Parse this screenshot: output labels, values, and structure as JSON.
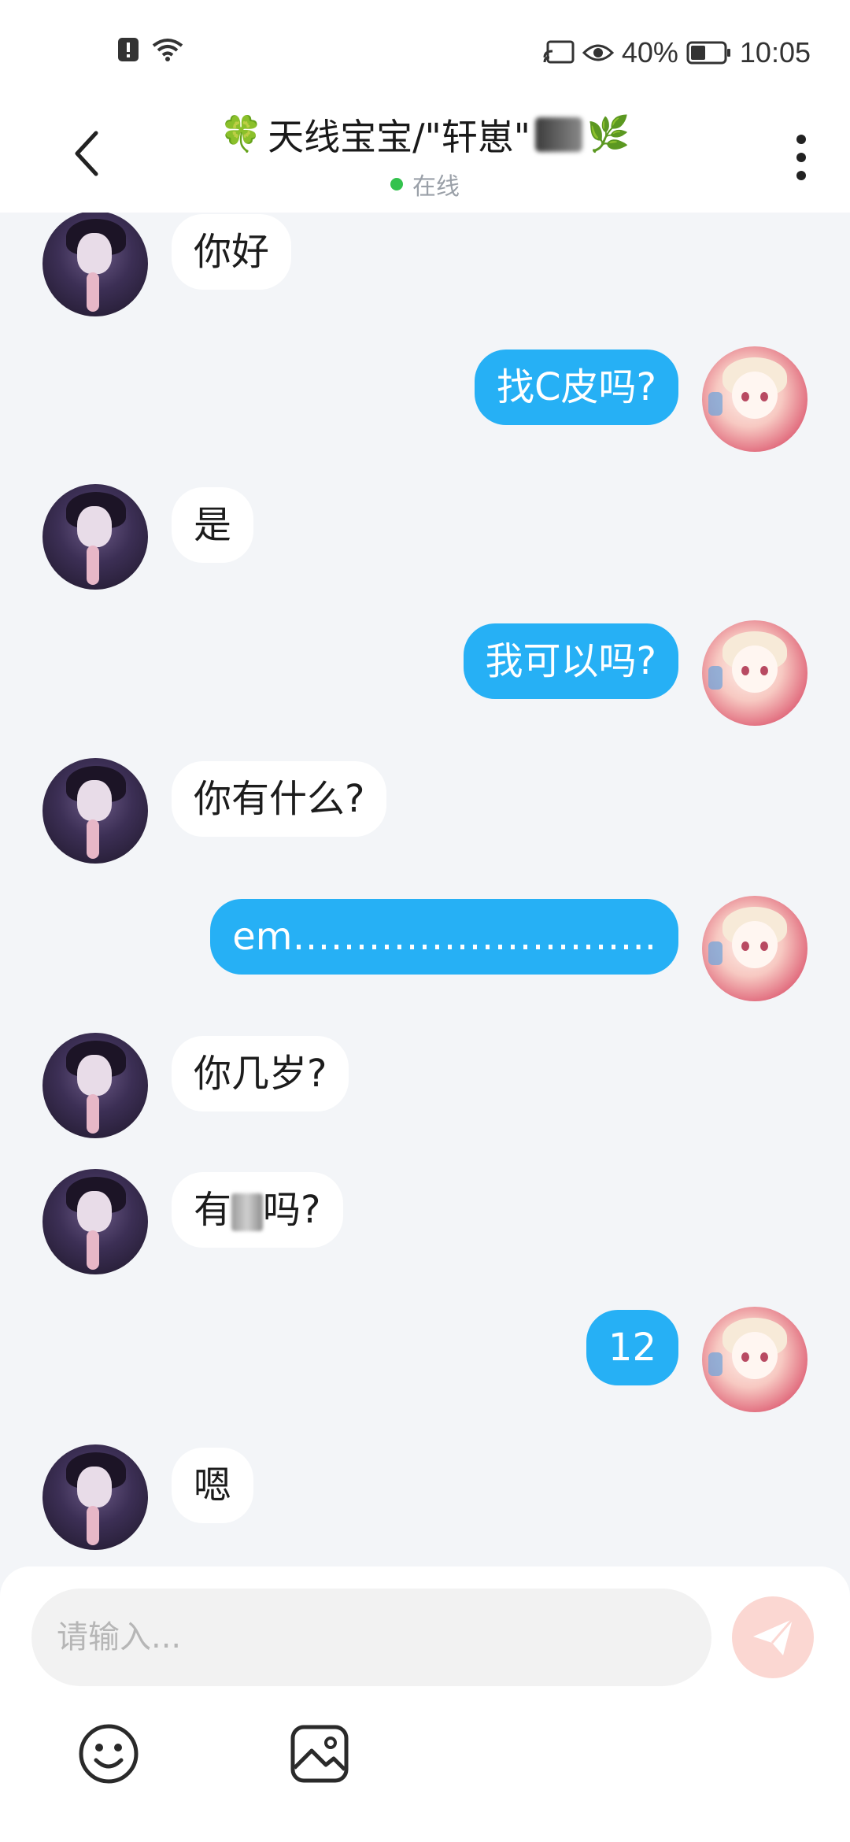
{
  "status_bar": {
    "battery_percent": "40%",
    "time": "10:05"
  },
  "header": {
    "title": "天线宝宝/\"轩崽\"",
    "title_prefix_emoji": "🍀",
    "title_suffix_emoji": "🌿",
    "presence": "在线"
  },
  "messages": [
    {
      "side": "in",
      "text": "你好"
    },
    {
      "side": "out",
      "text": "找C皮吗?"
    },
    {
      "side": "in",
      "text": "是"
    },
    {
      "side": "out",
      "text": "我可以吗?"
    },
    {
      "side": "in",
      "text": "你有什么?"
    },
    {
      "side": "out",
      "text": "em……………………….."
    },
    {
      "side": "in",
      "text": "你几岁?"
    },
    {
      "side": "in",
      "text_before": "有",
      "text_after": "吗?"
    },
    {
      "side": "out",
      "text": "12"
    },
    {
      "side": "in",
      "text": "嗯"
    }
  ],
  "composer": {
    "placeholder": "请输入..."
  },
  "colors": {
    "outgoing_bubble": "#26b0f5",
    "incoming_bubble": "#ffffff",
    "chat_background": "#f3f5f8",
    "send_button": "#fbd7d2",
    "presence_dot": "#33c24d"
  },
  "icons": {
    "status_left": [
      "alert-icon",
      "wifi-icon"
    ],
    "status_right": [
      "cast-icon",
      "eye-icon",
      "battery-icon"
    ],
    "header": [
      "back-arrow-icon",
      "more-vertical-icon"
    ],
    "composer": [
      "send-icon",
      "emoji-icon",
      "image-icon"
    ]
  }
}
